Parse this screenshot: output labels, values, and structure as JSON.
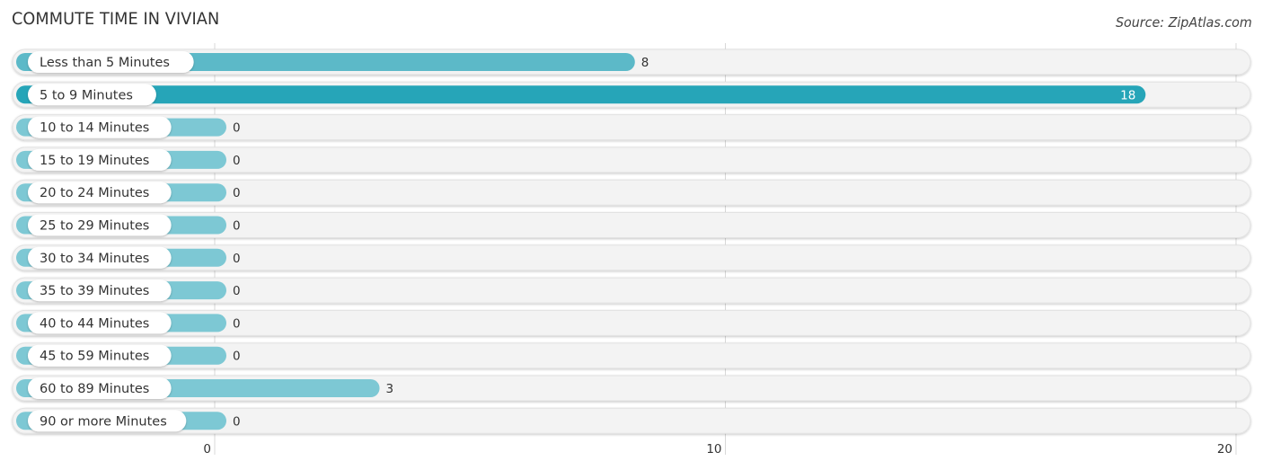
{
  "chart_data": {
    "type": "bar",
    "orientation": "horizontal",
    "title": "COMMUTE TIME IN VIVIAN",
    "source": "Source: ZipAtlas.com",
    "xlabel": "",
    "ylabel": "",
    "xlim": [
      0,
      20
    ],
    "ticks": [
      0,
      10,
      20
    ],
    "grid": true,
    "categories": [
      "Less than 5 Minutes",
      "5 to 9 Minutes",
      "10 to 14 Minutes",
      "15 to 19 Minutes",
      "20 to 24 Minutes",
      "25 to 29 Minutes",
      "30 to 34 Minutes",
      "35 to 39 Minutes",
      "40 to 44 Minutes",
      "45 to 59 Minutes",
      "60 to 89 Minutes",
      "90 or more Minutes"
    ],
    "values": [
      8,
      18,
      0,
      0,
      0,
      0,
      0,
      0,
      0,
      0,
      3,
      0
    ],
    "colors": {
      "default": "#7dc8d4",
      "secondary": "#5cb9c8",
      "highlight": "#26a5b8",
      "track": "#f3f3f3"
    }
  }
}
